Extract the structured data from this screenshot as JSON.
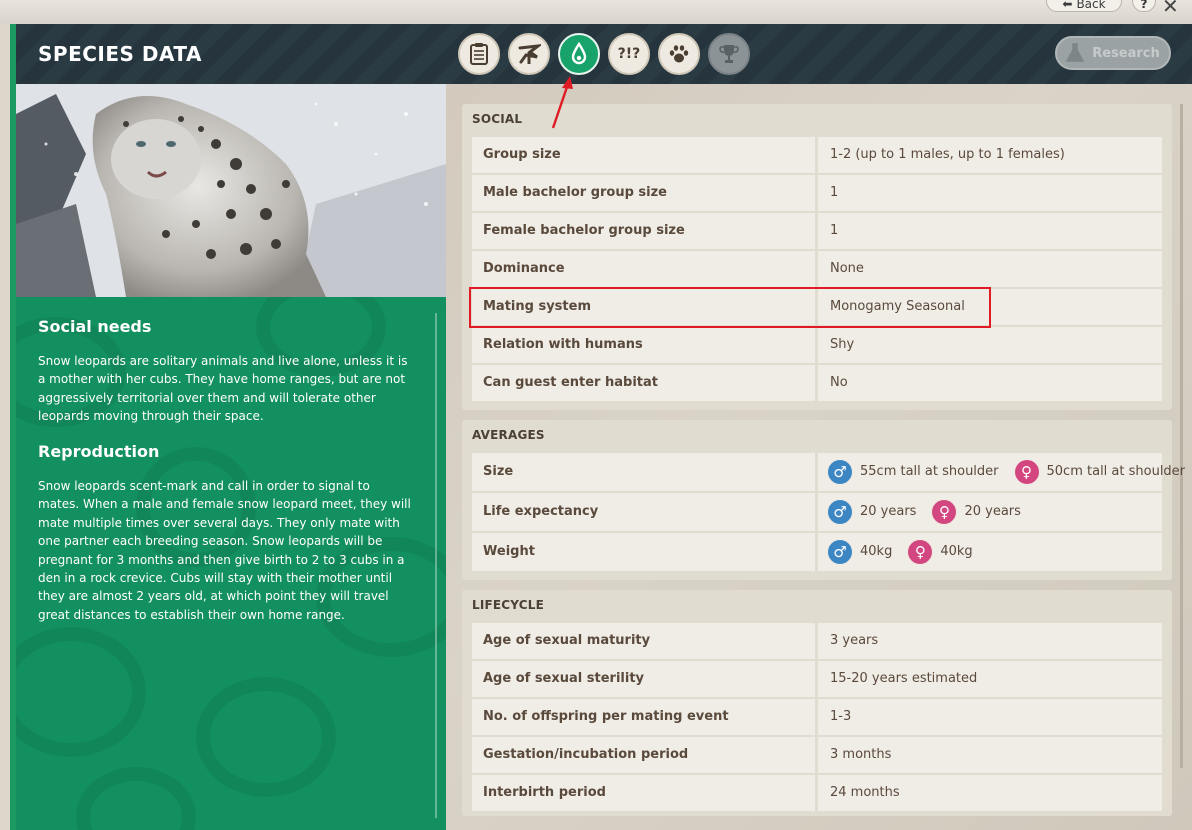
{
  "topbar": {
    "back_label": "Back",
    "help_label": "?",
    "close_label": "✕"
  },
  "header": {
    "title": "SPECIES DATA",
    "tabs": [
      {
        "name": "tab-overview",
        "icon": "clipboard-icon",
        "glyph": "▤"
      },
      {
        "name": "tab-habitat",
        "icon": "tree-icon",
        "glyph": "⛰"
      },
      {
        "name": "tab-social",
        "icon": "drop-icon",
        "glyph": "💧"
      },
      {
        "name": "tab-behaviour",
        "icon": "questions-icon",
        "glyph": "?!?"
      },
      {
        "name": "tab-enrichment",
        "icon": "paw-icon",
        "glyph": "🐾"
      },
      {
        "name": "tab-awards",
        "icon": "trophy-icon",
        "glyph": "🏆"
      }
    ],
    "research_label": "Research"
  },
  "colors": {
    "accent": "#13905f",
    "header": "#2b3b44",
    "highlight": "#e01b24",
    "male": "#3c86c4",
    "female": "#d4467f"
  },
  "left": {
    "social_heading": "Social needs",
    "social_text": "Snow leopards are solitary animals and live alone, unless it is a mother with her cubs. They have home ranges, but are not aggressively territorial over them and will tolerate other leopards moving through their space.",
    "repro_heading": "Reproduction",
    "repro_text": "Snow leopards scent-mark and call in order to signal to mates. When a male and female snow leopard meet, they will mate multiple times over several days. They only mate with one partner each breeding season. Snow leopards will be pregnant for 3 months and then give birth to 2 to 3 cubs in a den in a rock crevice. Cubs will stay with their mother until they are almost 2 years old, at which point they will travel great distances to establish their own home range."
  },
  "social": {
    "title": "SOCIAL",
    "rows": [
      {
        "label": "Group size",
        "value": "1-2 (up to 1 males, up to 1 females)"
      },
      {
        "label": "Male bachelor group size",
        "value": "1"
      },
      {
        "label": "Female bachelor group size",
        "value": "1"
      },
      {
        "label": "Dominance",
        "value": "None"
      },
      {
        "label": "Mating system",
        "value": "Monogamy Seasonal"
      },
      {
        "label": "Relation with humans",
        "value": "Shy"
      },
      {
        "label": "Can guest enter habitat",
        "value": "No"
      }
    ]
  },
  "averages": {
    "title": "AVERAGES",
    "male_symbol": "♂",
    "female_symbol": "♀",
    "rows": [
      {
        "label": "Size",
        "male": "55cm tall at shoulder",
        "female": "50cm tall at shoulder"
      },
      {
        "label": "Life expectancy",
        "male": "20 years",
        "female": "20 years"
      },
      {
        "label": "Weight",
        "male": "40kg",
        "female": "40kg"
      }
    ]
  },
  "lifecycle": {
    "title": "LIFECYCLE",
    "rows": [
      {
        "label": "Age of sexual maturity",
        "value": "3 years"
      },
      {
        "label": "Age of sexual sterility",
        "value": "15-20 years estimated"
      },
      {
        "label": "No. of offspring per mating event",
        "value": "1-3"
      },
      {
        "label": "Gestation/incubation period",
        "value": "3 months"
      },
      {
        "label": "Interbirth period",
        "value": "24 months"
      }
    ]
  }
}
